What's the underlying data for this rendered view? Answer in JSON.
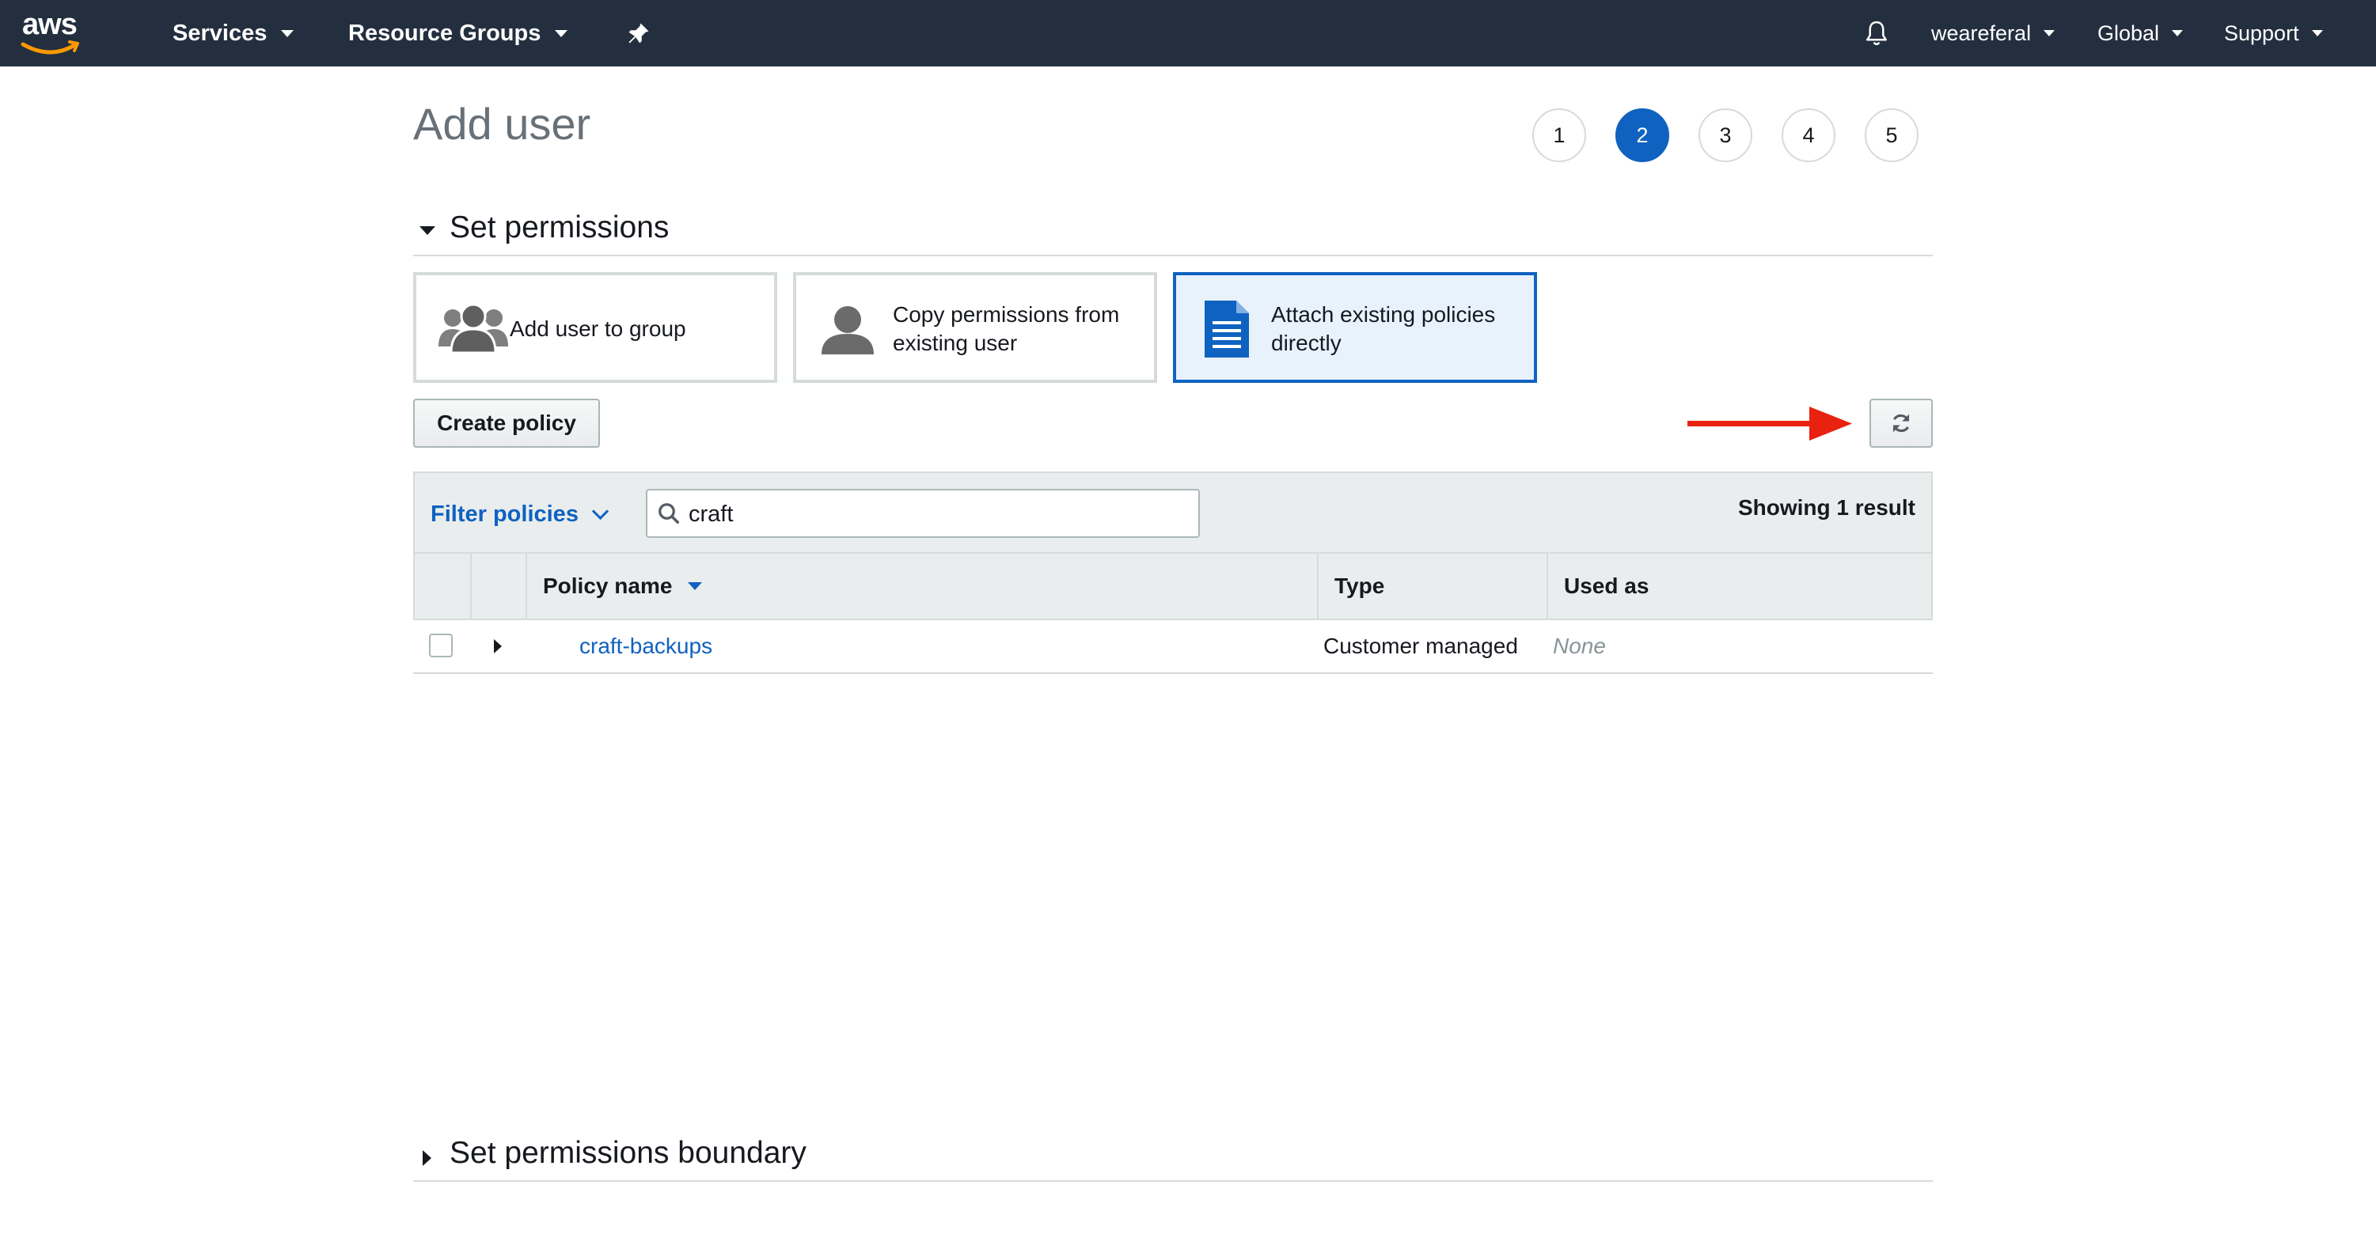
{
  "nav": {
    "logo_text": "aws",
    "services": "Services",
    "resource_groups": "Resource Groups",
    "account": "weareferal",
    "region": "Global",
    "support": "Support"
  },
  "page": {
    "title": "Add user",
    "steps": [
      "1",
      "2",
      "3",
      "4",
      "5"
    ],
    "active_step": 2
  },
  "permissions": {
    "section_title": "Set permissions",
    "options": [
      {
        "label_line1": "Add user to group",
        "label_line2": "",
        "icon": "group-icon",
        "selected": false
      },
      {
        "label_line1": "Copy permissions from",
        "label_line2": "existing user",
        "icon": "user-icon",
        "selected": false
      },
      {
        "label_line1": "Attach existing policies",
        "label_line2": "directly",
        "icon": "document-icon",
        "selected": true
      }
    ],
    "create_policy_label": "Create policy"
  },
  "filter": {
    "label": "Filter policies",
    "search_value": "craft",
    "result_text": "Showing 1 result"
  },
  "table": {
    "columns": [
      "Policy name",
      "Type",
      "Used as"
    ],
    "rows": [
      {
        "policy_name": "craft-backups",
        "type": "Customer managed",
        "used_as": "None"
      }
    ]
  },
  "boundary": {
    "section_title": "Set permissions boundary"
  },
  "colors": {
    "nav_bg": "#232f3e",
    "accent_blue": "#0f62c0",
    "annotation_red": "#e8220f"
  }
}
